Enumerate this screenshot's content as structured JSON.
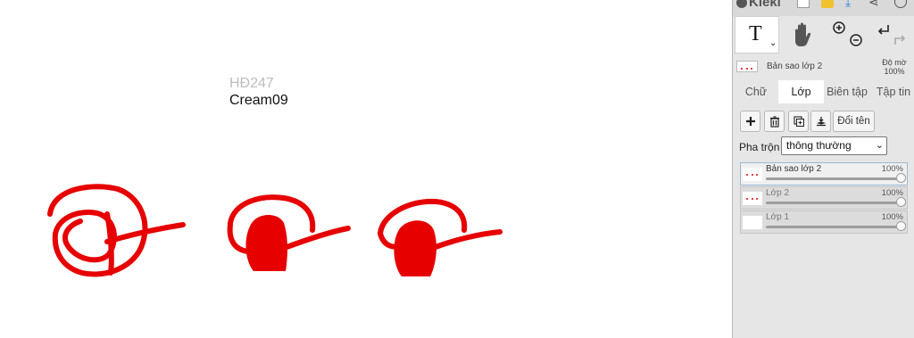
{
  "canvas": {
    "text_line_1": "HĐ247",
    "text_line_2": "Cream09",
    "stroke_color": "#e60000"
  },
  "topbar": {
    "app_name": "Kleki",
    "icons": [
      "logo-icon",
      "new-file-icon",
      "folder-icon",
      "download-icon",
      "share-icon",
      "help-icon"
    ]
  },
  "tools": {
    "text_tool_char": "T",
    "text_tool_caret": "⌄",
    "icons": [
      "text-tool-icon",
      "hand-tool-icon",
      "zoom-in-icon",
      "zoom-out-icon",
      "undo-icon",
      "redo-icon"
    ]
  },
  "layer_info": {
    "name": "Bản sao lớp 2",
    "opacity_label": "Độ mờ",
    "opacity_value": "100%"
  },
  "tabs": {
    "chu": "Chữ",
    "lop": "Lớp",
    "bien_tap": "Biên tập",
    "tap_tin": "Tập tin"
  },
  "layer_controls": {
    "rename_label": "Đổi tên",
    "blend_label": "Pha trộn",
    "blend_value": "thông thường"
  },
  "layers": [
    {
      "name": "Bản sao lớp 2",
      "opacity": "100%",
      "active": true
    },
    {
      "name": "Lớp 2",
      "opacity": "100%",
      "active": false
    },
    {
      "name": "Lớp 1",
      "opacity": "100%",
      "active": false
    }
  ],
  "colors": {
    "accent": "#2f7de1",
    "panel_bg": "#e6e6e6",
    "stroke_red": "#e60000"
  }
}
